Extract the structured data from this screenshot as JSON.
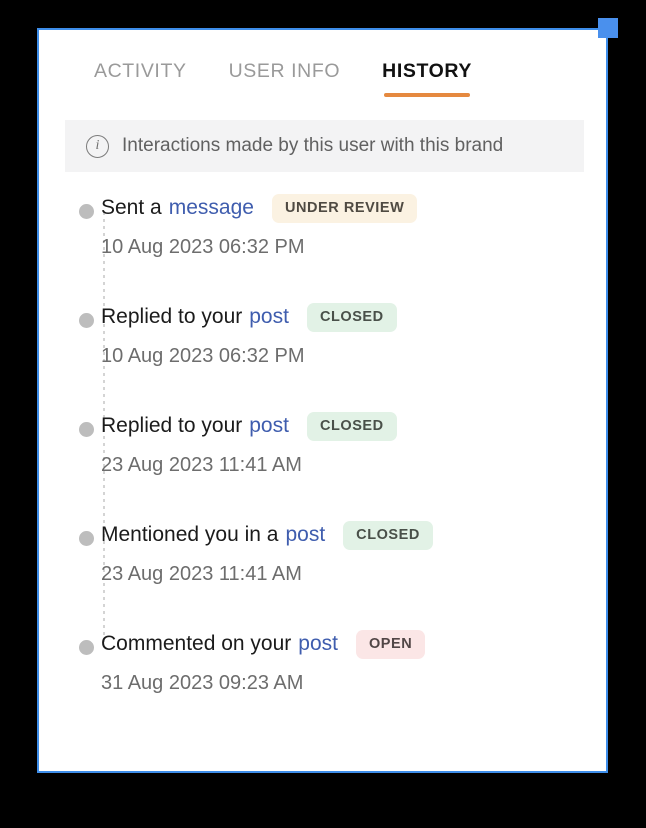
{
  "colors": {
    "panel_border": "#3e8eea",
    "corner_handle": "#4a90ed",
    "active_tab_underline": "#e5893f",
    "link": "#3f5dae",
    "badge_under_review_bg": "#fbf2e2",
    "badge_closed_bg": "#e2f2e6",
    "badge_open_bg": "#fbe6e6",
    "infobar_bg": "#f3f3f4",
    "timeline_dot": "#bdbdbd"
  },
  "tabs": [
    {
      "label": "ACTIVITY",
      "active": false
    },
    {
      "label": "USER INFO",
      "active": false
    },
    {
      "label": "HISTORY",
      "active": true
    }
  ],
  "infobar": {
    "icon": "info-circle-icon",
    "text": "Interactions made by this user with this brand"
  },
  "timeline": {
    "events": [
      {
        "text": "Sent a",
        "link": "message",
        "status": "UNDER REVIEW",
        "status_kind": "under-review",
        "time": "10 Aug 2023 06:32 PM"
      },
      {
        "text": "Replied to your",
        "link": "post",
        "status": "CLOSED",
        "status_kind": "closed",
        "time": "10 Aug 2023 06:32 PM"
      },
      {
        "text": "Replied to your",
        "link": "post",
        "status": "CLOSED",
        "status_kind": "closed",
        "time": "23 Aug 2023 11:41 AM"
      },
      {
        "text": "Mentioned you in a",
        "link": "post",
        "status": "CLOSED",
        "status_kind": "closed",
        "time": "23 Aug 2023 11:41 AM"
      },
      {
        "text": "Commented on your",
        "link": "post",
        "status": "OPEN",
        "status_kind": "open",
        "time": "31 Aug 2023 09:23 AM"
      }
    ]
  }
}
